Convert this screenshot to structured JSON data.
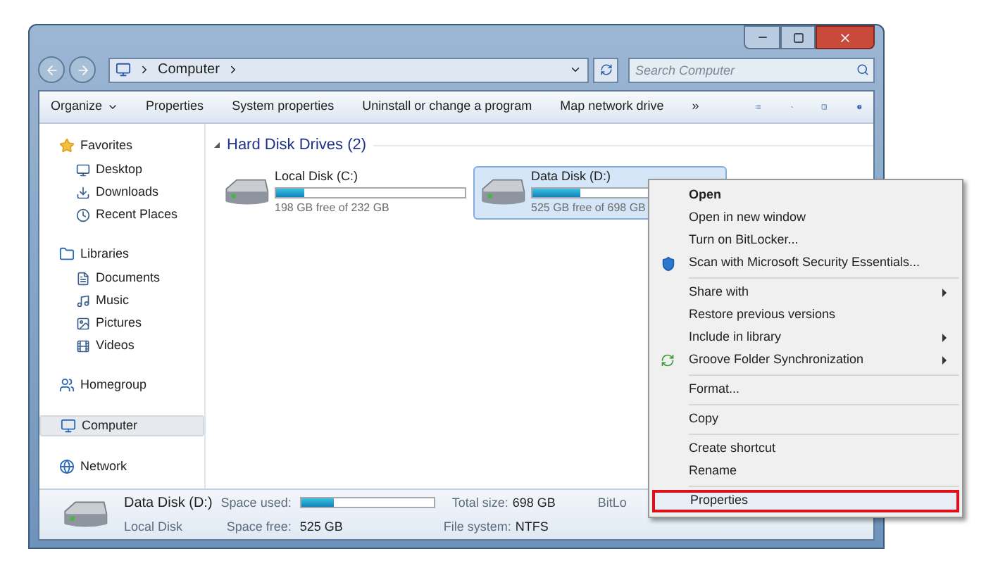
{
  "address": {
    "crumbs": [
      "Computer"
    ],
    "search_placeholder": "Search Computer"
  },
  "toolbar": [
    {
      "label": "Organize",
      "kind": "dropdown"
    },
    {
      "label": "Properties",
      "kind": "button"
    },
    {
      "label": "System properties",
      "kind": "button"
    },
    {
      "label": "Uninstall or change a program",
      "kind": "button"
    },
    {
      "label": "Map network drive",
      "kind": "button"
    },
    {
      "label": "»",
      "kind": "button"
    }
  ],
  "sidebar": {
    "groups": [
      {
        "label": "Favorites",
        "selected": false,
        "children": [
          {
            "label": "Desktop",
            "selected": false
          },
          {
            "label": "Downloads",
            "selected": false
          },
          {
            "label": "Recent Places",
            "selected": false
          }
        ]
      },
      {
        "label": "Libraries",
        "selected": false,
        "children": [
          {
            "label": "Documents",
            "selected": false
          },
          {
            "label": "Music",
            "selected": false
          },
          {
            "label": "Pictures",
            "selected": false
          },
          {
            "label": "Videos",
            "selected": false
          }
        ]
      },
      {
        "label": "Homegroup",
        "selected": false
      },
      {
        "label": "Computer",
        "selected": true
      },
      {
        "label": "Network",
        "selected": false
      }
    ]
  },
  "content": {
    "group_header": "Hard Disk Drives (2)",
    "drives": [
      {
        "name": "Local Disk (C:)",
        "level": 0.15,
        "free_text": "198 GB free of 232 GB",
        "selected": false
      },
      {
        "name": "Data Disk (D:)",
        "level": 0.25,
        "free_text": "525 GB free of 698 GB",
        "selected": true
      }
    ]
  },
  "details": {
    "name": "Data Disk (D:)",
    "type": "Local Disk",
    "space_used_label": "Space used:",
    "level": 0.25,
    "space_free_label": "Space free:",
    "space_free": "525 GB",
    "total_size_label": "Total size:",
    "total_size": "698 GB",
    "file_system_label": "File system:",
    "file_system": "NTFS",
    "bitlocker_label": "BitLo"
  },
  "context_menu": [
    {
      "kind": "item",
      "label": "Open",
      "default": true,
      "submenu": false,
      "selected": false
    },
    {
      "kind": "item",
      "label": "Open in new window",
      "default": false,
      "submenu": false,
      "selected": false
    },
    {
      "kind": "item",
      "label": "Turn on BitLocker...",
      "default": false,
      "submenu": false,
      "selected": false
    },
    {
      "kind": "item",
      "label": "Scan with Microsoft Security Essentials...",
      "default": false,
      "submenu": false,
      "selected": false
    },
    {
      "kind": "separator"
    },
    {
      "kind": "item",
      "label": "Share with",
      "default": false,
      "submenu": true,
      "selected": false
    },
    {
      "kind": "item",
      "label": "Restore previous versions",
      "default": false,
      "submenu": false,
      "selected": false
    },
    {
      "kind": "item",
      "label": "Include in library",
      "default": false,
      "submenu": true,
      "selected": false
    },
    {
      "kind": "item",
      "label": "Groove Folder Synchronization",
      "default": false,
      "submenu": true,
      "selected": false
    },
    {
      "kind": "separator"
    },
    {
      "kind": "item",
      "label": "Format...",
      "default": false,
      "submenu": false,
      "selected": false
    },
    {
      "kind": "separator"
    },
    {
      "kind": "item",
      "label": "Copy",
      "default": false,
      "submenu": false,
      "selected": false
    },
    {
      "kind": "separator"
    },
    {
      "kind": "item",
      "label": "Create shortcut",
      "default": false,
      "submenu": false,
      "selected": false
    },
    {
      "kind": "item",
      "label": "Rename",
      "default": false,
      "submenu": false,
      "selected": false
    },
    {
      "kind": "separator"
    },
    {
      "kind": "item",
      "label": "Properties",
      "default": false,
      "submenu": false,
      "selected": true
    }
  ]
}
